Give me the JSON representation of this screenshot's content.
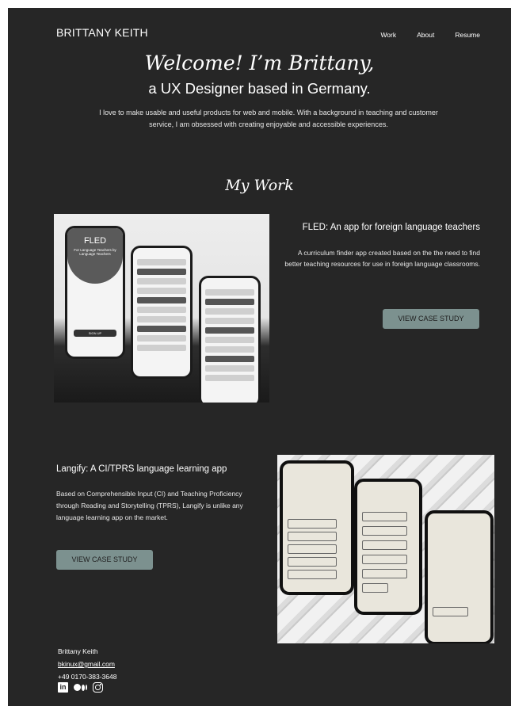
{
  "header": {
    "brand": "BRITTANY KEITH",
    "nav": [
      {
        "label": "Work"
      },
      {
        "label": "About"
      },
      {
        "label": "Resume"
      }
    ]
  },
  "hero": {
    "title": "Welcome! I’m Brittany,",
    "subtitle": "a UX Designer based in Germany.",
    "description": "I love to make usable and useful products for web and mobile. With a background in teaching and customer service, I am obsessed with creating enjoyable and accessible experiences."
  },
  "work": {
    "heading": "My Work",
    "projects": [
      {
        "title": "FLED: An app for foreign language teachers",
        "description": "A curriculum finder app created based on the the need to find better teaching resources for use in foreign language classrooms.",
        "button_label": "VIEW CASE STUDY",
        "mockup": {
          "logo": "FLED",
          "tagline": "For Language Teachers by Language Teachers",
          "signup": "SIGN UP"
        }
      },
      {
        "title": "Langify: A CI/TPRS language learning app",
        "description": "Based on Comprehensible Input (CI) and Teaching Proficiency through Reading and Storytelling (TPRS), Langify is unlike any language learning app on the market.",
        "button_label": "VIEW CASE STUDY"
      }
    ]
  },
  "footer": {
    "name": "Brittany Keith",
    "email": "bkinux@gmail.com",
    "phone": "+49 0170-383-3648",
    "social": [
      "linkedin-icon",
      "medium-icon",
      "instagram-icon"
    ]
  },
  "colors": {
    "background": "#262626",
    "button": "#7c918f",
    "text": "#ffffff"
  }
}
